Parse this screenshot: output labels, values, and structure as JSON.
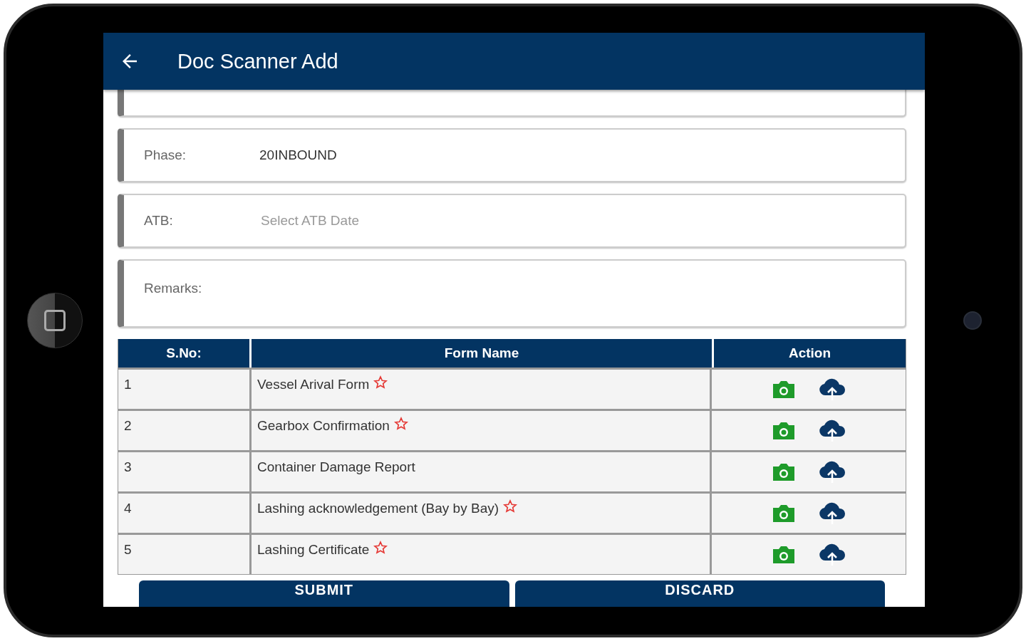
{
  "app_bar": {
    "title": "Doc Scanner Add"
  },
  "fields": [
    {
      "kind": "text",
      "label": "Phase:",
      "value": "20INBOUND"
    },
    {
      "kind": "date",
      "label": "ATB:",
      "placeholder": "Select ATB Date"
    },
    {
      "kind": "textarea",
      "label": "Remarks:"
    }
  ],
  "table": {
    "columns": [
      "S.No:",
      "Form Name",
      "Action"
    ],
    "rows": [
      {
        "sno": "1",
        "form_name": "Vessel Arival Form",
        "required": true
      },
      {
        "sno": "2",
        "form_name": "Gearbox Confirmation",
        "required": true
      },
      {
        "sno": "3",
        "form_name": "Container Damage Report",
        "required": false
      },
      {
        "sno": "4",
        "form_name": "Lashing acknowledgement (Bay by Bay)",
        "required": true
      },
      {
        "sno": "5",
        "form_name": "Lashing Certificate",
        "required": true
      }
    ]
  },
  "buttons": [
    "SUBMIT",
    "DISCARD"
  ]
}
